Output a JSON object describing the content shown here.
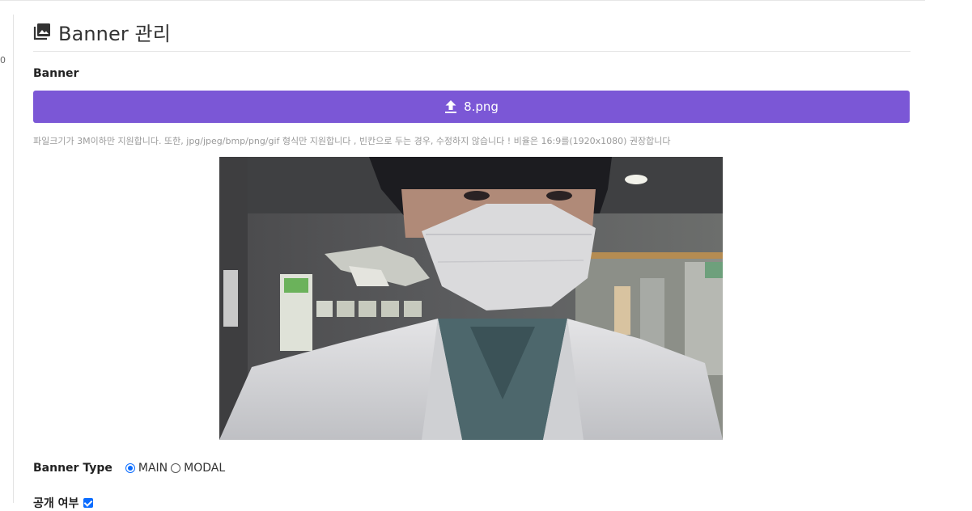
{
  "sidebar": {
    "stub_text": "0"
  },
  "page": {
    "title": "Banner 관리",
    "title_icon": "image-icon"
  },
  "banner": {
    "label": "Banner",
    "upload_filename": "8.png",
    "upload_icon": "upload-icon",
    "upload_color": "#7b57d6",
    "help_text": "파일크기가 3M이하만 지원합니다. 또한, jpg/jpeg/bmp/png/gif 형식만 지원합니다 , 빈칸으로 두는 경우, 수정하지 않습니다 ! 비율은 16:9를(1920x1080) 권장합니다"
  },
  "banner_type": {
    "label": "Banner Type",
    "options": [
      {
        "label": "MAIN",
        "checked": true
      },
      {
        "label": "MODAL",
        "checked": false
      }
    ]
  },
  "public": {
    "label": "공개 여부",
    "checked": true
  }
}
